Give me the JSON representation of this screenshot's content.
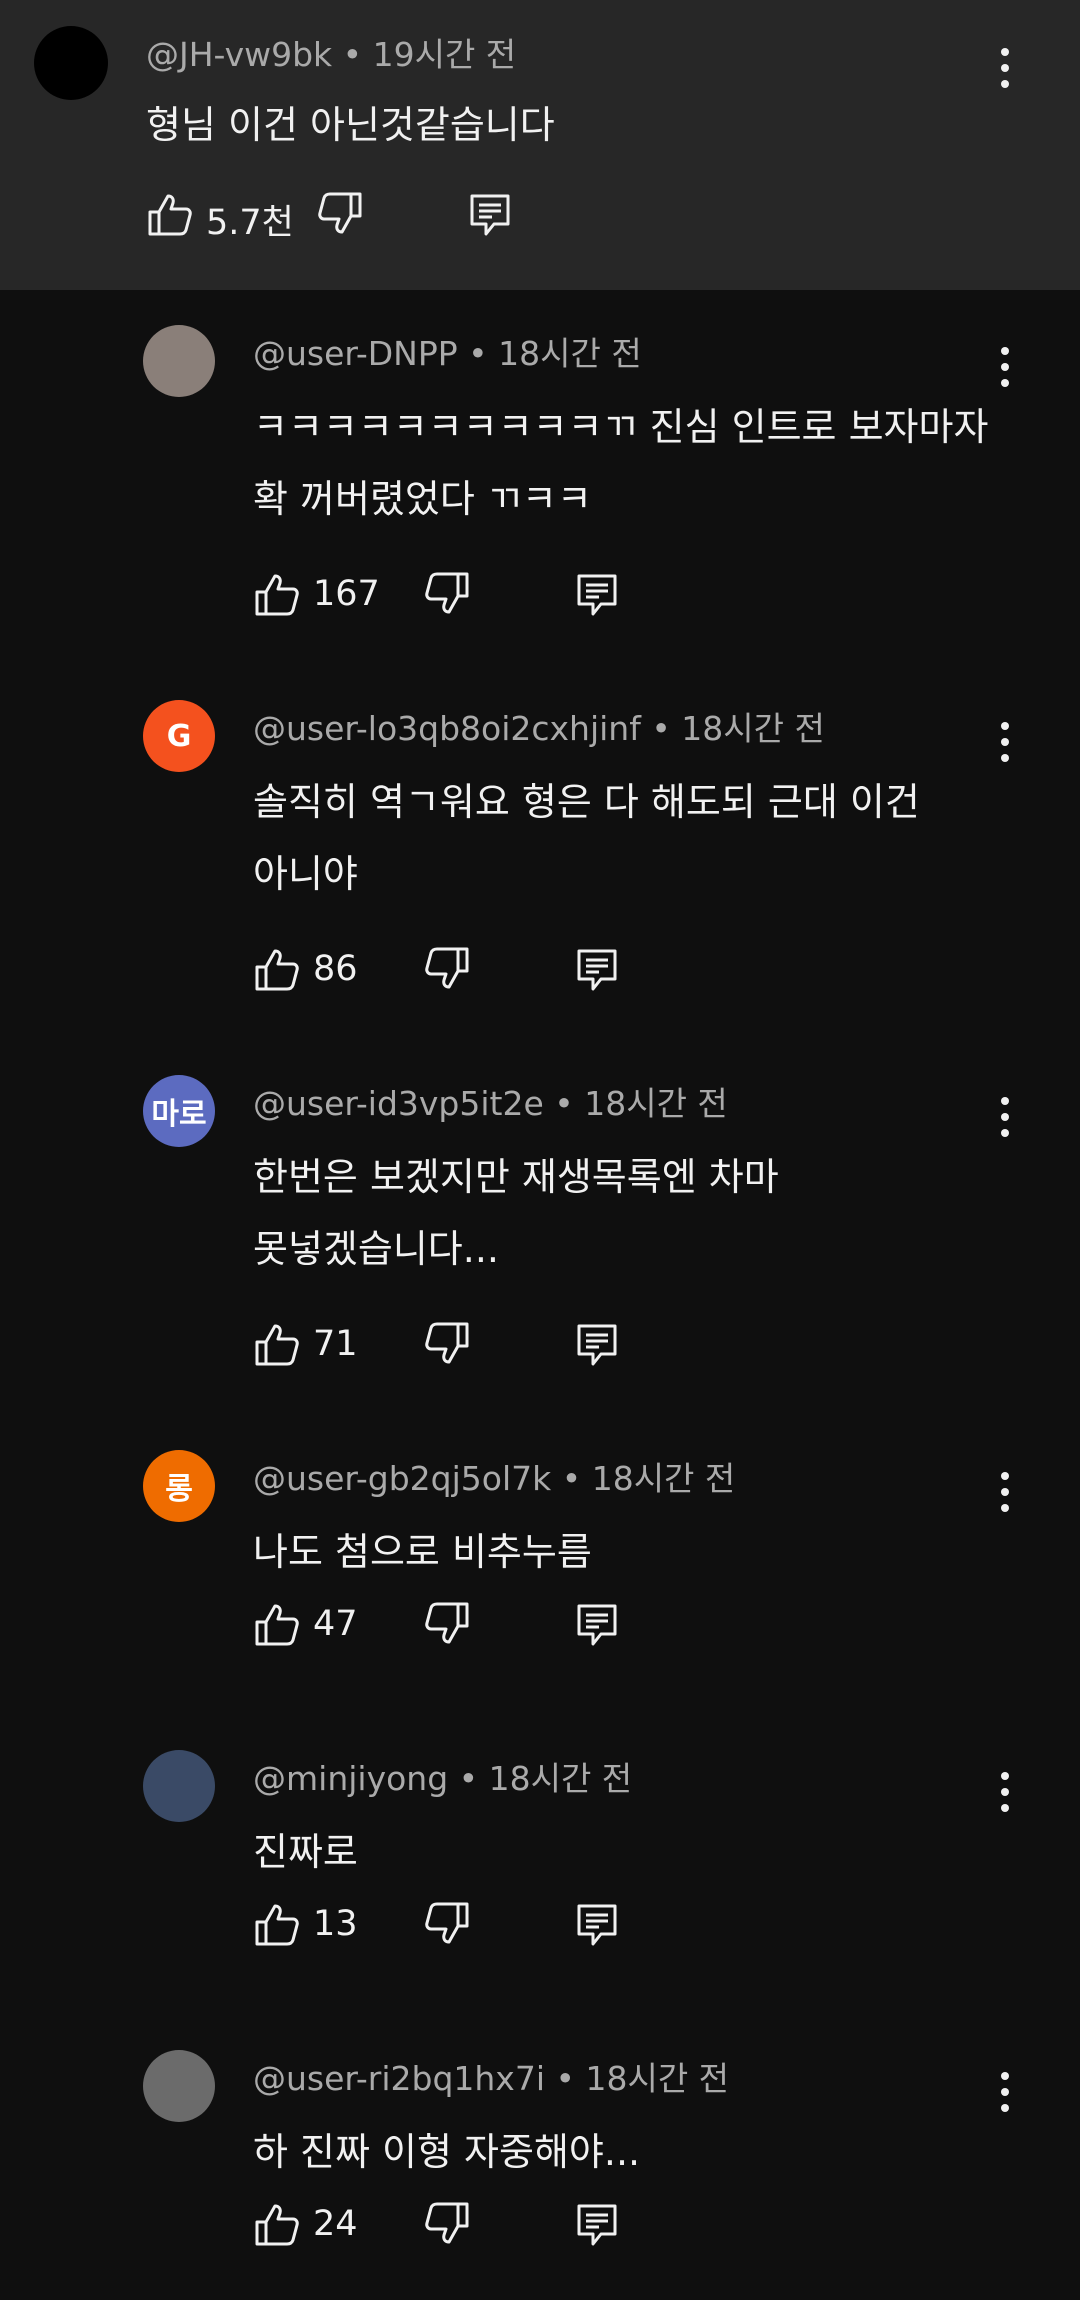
{
  "parent_comment": {
    "author": "@JH-vw9bk",
    "time": "19시간 전",
    "text": "형님 이건 아닌것같습니다",
    "likes": "5.7천",
    "avatar_color": "#000000"
  },
  "replies": [
    {
      "author": "@user-DNPP",
      "time": "18시간 전",
      "text": "ㅋㅋㅋㅋㅋㅋㅋㅋㅋㅋㄲ 진심 인트로 보자마자\n확 꺼버렸었다 ㄲㅋㅋ",
      "likes": "167",
      "avatar_letter": "",
      "avatar_color": "#8a7f79"
    },
    {
      "author": "@user-lo3qb8oi2cxhjinf",
      "time": "18시간 전",
      "text": "솔직히 역ㄱ워요 형은 다 해도되 근대 이건\n아니야",
      "likes": "86",
      "avatar_letter": "G",
      "avatar_color": "#f4511e"
    },
    {
      "author": "@user-id3vp5it2e",
      "time": "18시간 전",
      "text": "한번은 보겠지만 재생목록엔 차마\n못넣겠습니다...",
      "likes": "71",
      "avatar_letter": "마로",
      "avatar_color": "#5c6bc0"
    },
    {
      "author": "@user-gb2qj5ol7k",
      "time": "18시간 전",
      "text": "나도 첨으로 비추누름",
      "likes": "47",
      "avatar_letter": "롱",
      "avatar_color": "#ef6c00"
    },
    {
      "author": "@minjiyong",
      "time": "18시간 전",
      "text": "진짜로",
      "likes": "13",
      "avatar_letter": "",
      "avatar_color": "#3a4a66"
    },
    {
      "author": "@user-ri2bq1hx7i",
      "time": "18시간 전",
      "text": "하 진짜 이형 자중해야...",
      "likes": "24",
      "avatar_letter": "",
      "avatar_color": "#6b6b6b"
    }
  ],
  "separator": " • "
}
